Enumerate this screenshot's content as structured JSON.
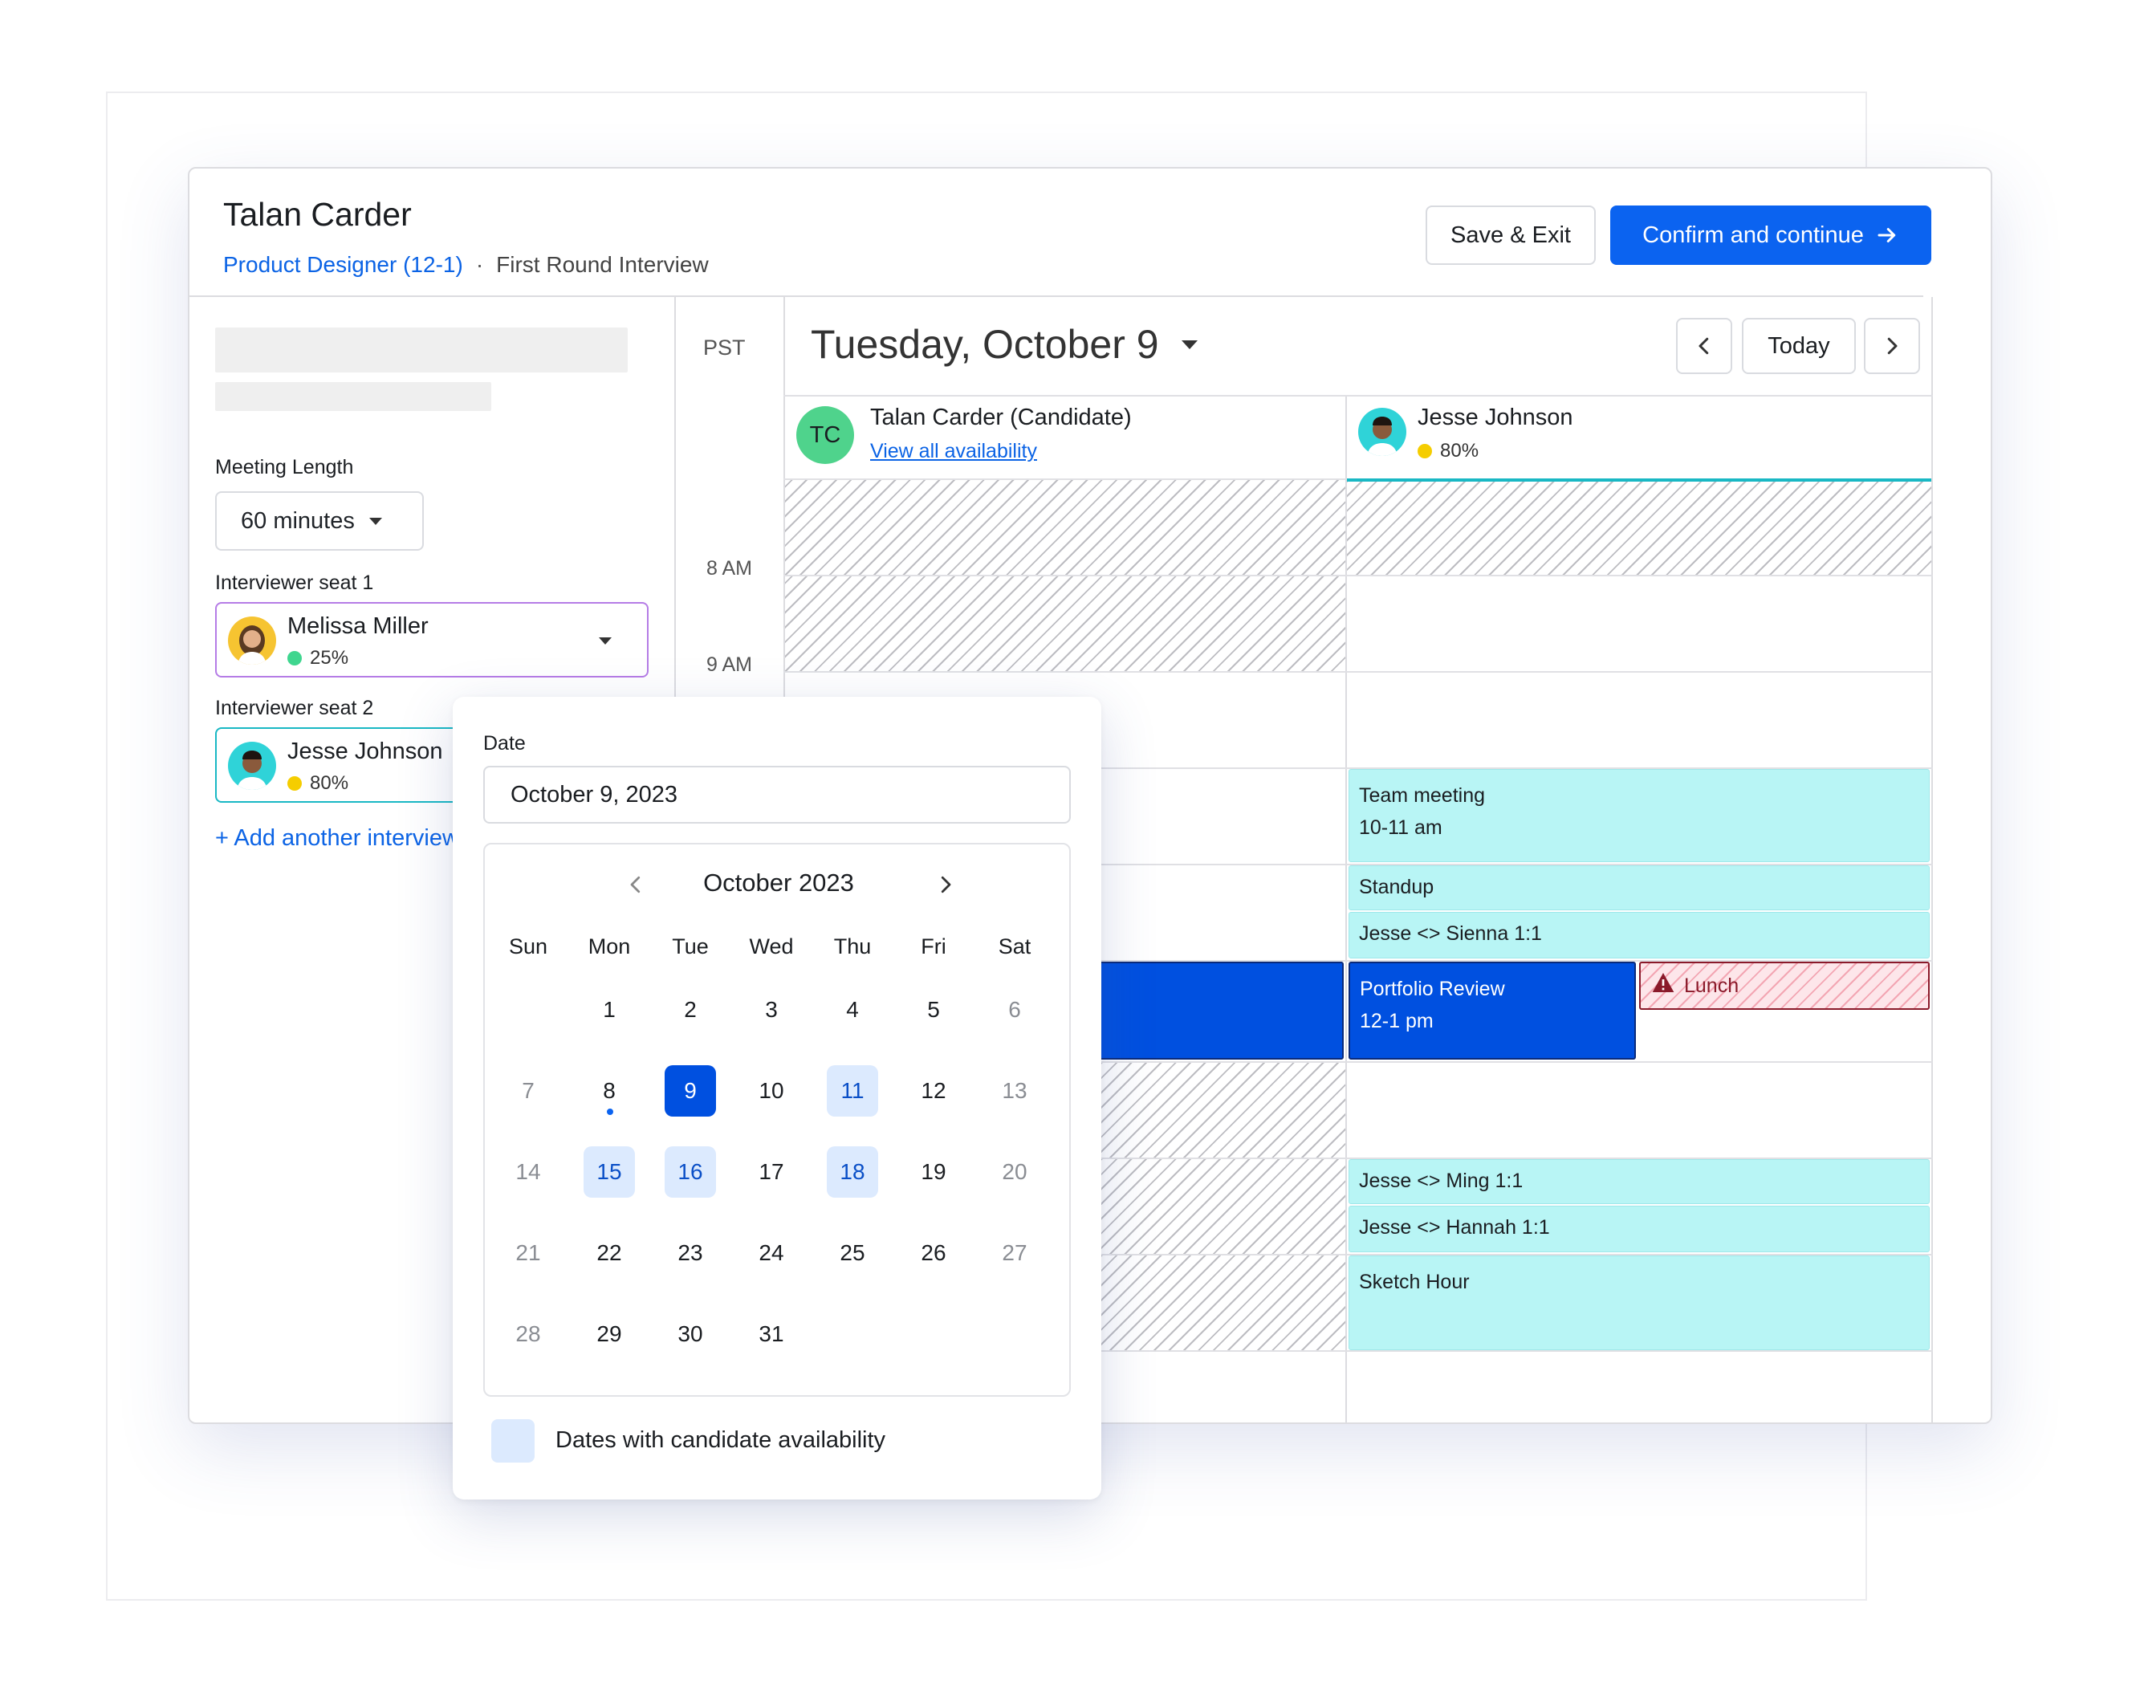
{
  "header": {
    "candidate_name": "Talan Carder",
    "job_link": "Product Designer (12-1)",
    "separator": "·",
    "stage": "First Round Interview",
    "save_label": "Save & Exit",
    "confirm_label": "Confirm and continue"
  },
  "left_panel": {
    "meeting_length_label": "Meeting Length",
    "meeting_length_value": "60 minutes",
    "seat1_label": "Interviewer seat 1",
    "seat1_name": "Melissa Miller",
    "seat1_pct": "25%",
    "seat2_label": "Interviewer seat 2",
    "seat2_name": "Jesse Johnson",
    "seat2_pct": "80%",
    "add_link": "+ Add another interviewer"
  },
  "calendar": {
    "timezone": "PST",
    "date_title": "Tuesday, October 9",
    "today_label": "Today",
    "times": [
      "8 AM",
      "9 AM"
    ],
    "candidate_initials": "TC",
    "candidate_col_name": "Talan Carder (Candidate)",
    "candidate_col_link": "View all availability",
    "interviewer_col_name": "Jesse Johnson",
    "interviewer_col_pct": "80%",
    "events": {
      "team_meeting_title": "Team meeting",
      "team_meeting_time": "10-11 am",
      "standup": "Standup",
      "jesse_sienna": "Jesse <> Sienna 1:1",
      "portfolio_title": "Portfolio Review",
      "portfolio_time": "12-1 pm",
      "lunch": "Lunch",
      "jesse_ming": "Jesse <> Ming 1:1",
      "jesse_hannah": "Jesse <> Hannah 1:1",
      "sketch_hour": "Sketch Hour"
    }
  },
  "date_popover": {
    "label": "Date",
    "input_value": "October 9, 2023",
    "month_title": "October 2023",
    "weekdays": [
      "Sun",
      "Mon",
      "Tue",
      "Wed",
      "Thu",
      "Fri",
      "Sat"
    ],
    "weeks": [
      [
        "",
        "1",
        "2",
        "3",
        "4",
        "5",
        "6"
      ],
      [
        "7",
        "8",
        "9",
        "10",
        "11",
        "12",
        "13"
      ],
      [
        "14",
        "15",
        "16",
        "17",
        "18",
        "19",
        "20"
      ],
      [
        "21",
        "22",
        "23",
        "24",
        "25",
        "26",
        "27"
      ],
      [
        "28",
        "29",
        "30",
        "31",
        "",
        "",
        ""
      ]
    ],
    "selected_day": "9",
    "today_day": "8",
    "available_days": [
      "11",
      "15",
      "16",
      "18"
    ],
    "legend": "Dates with candidate availability"
  },
  "colors": {
    "accent_blue": "#0b63f0",
    "event_teal": "#b8f5f5",
    "event_blue": "#0050e0",
    "lunch_red": "#8a1a2a",
    "available_fill": "#dceafe",
    "status_green": "#3fd68f",
    "status_yellow": "#f5cd00"
  },
  "icons": {
    "confirm": "arrow-right-icon",
    "title_dropdown": "caret-down-icon",
    "prev": "chevron-left-icon",
    "next": "chevron-right-icon",
    "lunch": "warning-icon"
  }
}
